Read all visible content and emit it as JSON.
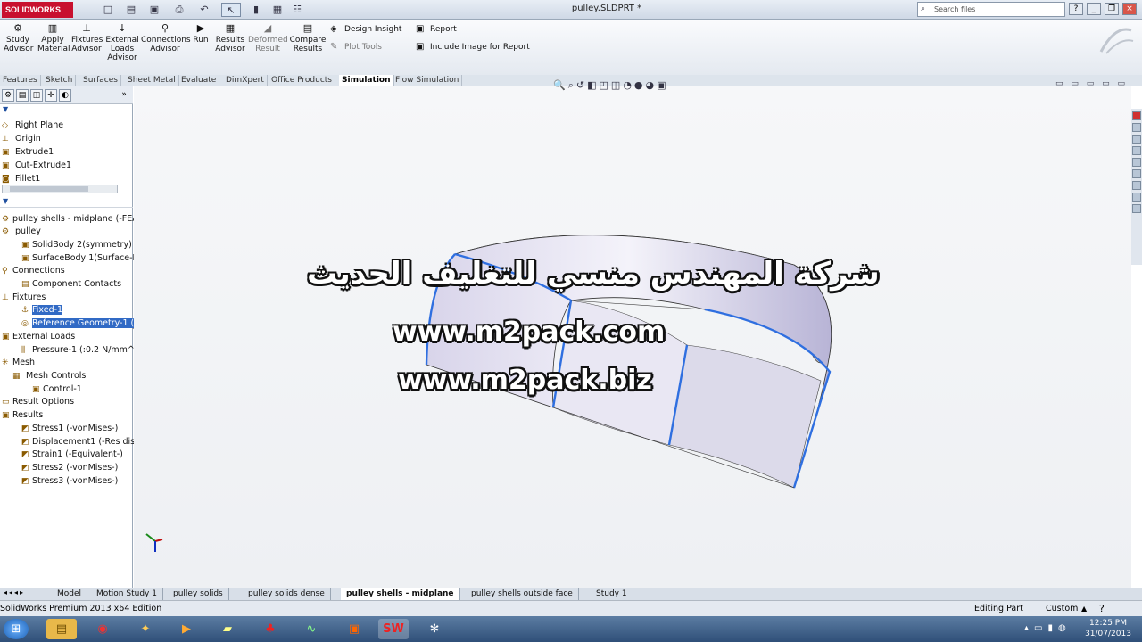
{
  "app": {
    "logo": "SOLIDWORKS",
    "doc_title": "pulley.SLDPRT *",
    "search_placeholder": "Search files"
  },
  "ribbon": {
    "commands": [
      {
        "label": "Study Advisor",
        "icon": "study-advisor-icon"
      },
      {
        "label": "Apply Material",
        "icon": "material-icon"
      },
      {
        "label": "Fixtures Advisor",
        "icon": "fixture-icon"
      },
      {
        "label": "External Loads Advisor",
        "icon": "load-icon"
      },
      {
        "label": "Connections Advisor",
        "icon": "connections-icon"
      },
      {
        "label": "Run",
        "icon": "run-icon"
      },
      {
        "label": "Results Advisor",
        "icon": "results-icon"
      },
      {
        "label": "Deformed Result",
        "icon": "deformed-icon"
      },
      {
        "label": "Compare Results",
        "icon": "compare-icon"
      }
    ],
    "side_commands": {
      "design_insight": "Design Insight",
      "plot_tools": "Plot Tools",
      "report": "Report",
      "include_image": "Include Image for Report"
    }
  },
  "tabs": [
    "Features",
    "Sketch",
    "Surfaces",
    "Sheet Metal",
    "Evaluate",
    "DimXpert",
    "Office Products",
    "Simulation",
    "Flow Simulation"
  ],
  "active_tab": "Simulation",
  "feature_tree": [
    "Right Plane",
    "Origin",
    "Extrude1",
    "Cut-Extrude1",
    "Fillet1"
  ],
  "study_tree": {
    "root": "pulley shells - midplane (-FEA-",
    "pulley": "pulley",
    "solidbody": "SolidBody 2(symmetry) (",
    "surfacebody": "SurfaceBody 1(Surface-M",
    "connections": "Connections",
    "component_contacts": "Component Contacts",
    "fixtures": "Fixtures",
    "fixed": "Fixed-1",
    "refgeom": "Reference Geometry-1 (-",
    "external_loads": "External Loads",
    "pressure": "Pressure-1 (:0.2 N/mm^2",
    "mesh": "Mesh",
    "mesh_controls": "Mesh Controls",
    "control": "Control-1",
    "result_options": "Result Options",
    "results": "Results",
    "stress1": "Stress1 (-vonMises-)",
    "displacement1": "Displacement1 (-Res disp",
    "strain1": "Strain1 (-Equivalent-)",
    "stress2": "Stress2 (-vonMises-)",
    "stress3": "Stress3 (-vonMises-)"
  },
  "watermark": {
    "arabic": "شركة المهندس منسي للتغليف الحديث",
    "url1": "www.m2pack.com",
    "url2": "www.m2pack.biz"
  },
  "bottom_tabs": [
    "Model",
    "Motion Study 1",
    "pulley solids",
    "pulley solids dense",
    "pulley shells - midplane",
    "pulley shells outside face",
    "Study 1"
  ],
  "active_bottom_tab": "pulley shells - midplane",
  "status": {
    "edition": "SolidWorks Premium 2013 x64 Edition",
    "mode": "Editing Part",
    "units": "Custom"
  },
  "clock": {
    "time": "12:25 PM",
    "date": "31/07/2013"
  },
  "colors": {
    "accent": "#316ac5",
    "brand": "#c8102e",
    "edge": "#2f6fe0"
  }
}
